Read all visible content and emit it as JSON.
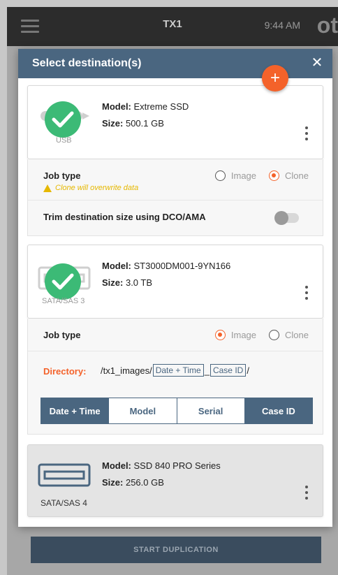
{
  "app": {
    "title": "TX1",
    "time": "9:44 AM",
    "logo": "ot",
    "start_label": "START DUPLICATION"
  },
  "modal": {
    "title": "Select destination(s)",
    "close_icon": "✕",
    "add_icon": "+"
  },
  "drives": [
    {
      "interface": "USB",
      "model_label": "Model:",
      "model": "Extreme SSD",
      "size_label": "Size:",
      "size": "500.1 GB",
      "selected": true
    },
    {
      "interface": "SATA/SAS 3",
      "model_label": "Model:",
      "model": "ST3000DM001-9YN166",
      "size_label": "Size:",
      "size": "3.0 TB",
      "selected": true
    },
    {
      "interface": "SATA/SAS 4",
      "model_label": "Model:",
      "model": "SSD 840 PRO Series",
      "size_label": "Size:",
      "size": "256.0 GB",
      "selected": false
    }
  ],
  "drive1_options": {
    "job_type_label": "Job type",
    "warning": "Clone will overwrite data",
    "image_label": "Image",
    "clone_label": "Clone",
    "selected": "Clone",
    "trim_label": "Trim destination size using DCO/AMA",
    "trim_on": false
  },
  "drive2_options": {
    "job_type_label": "Job type",
    "image_label": "Image",
    "clone_label": "Clone",
    "selected": "Image",
    "directory_label": "Directory:",
    "path_prefix": "/tx1_images/",
    "token1": "Date + Time",
    "sep": "_",
    "token2": "Case ID",
    "path_suffix": "/",
    "buttons": [
      "Date + Time",
      "Model",
      "Serial",
      "Case ID"
    ],
    "buttons_active": [
      true,
      false,
      false,
      true
    ]
  },
  "colors": {
    "accent": "#f4622a",
    "header": "#4a6680",
    "check": "#3cba76",
    "warn": "#e6b800"
  }
}
